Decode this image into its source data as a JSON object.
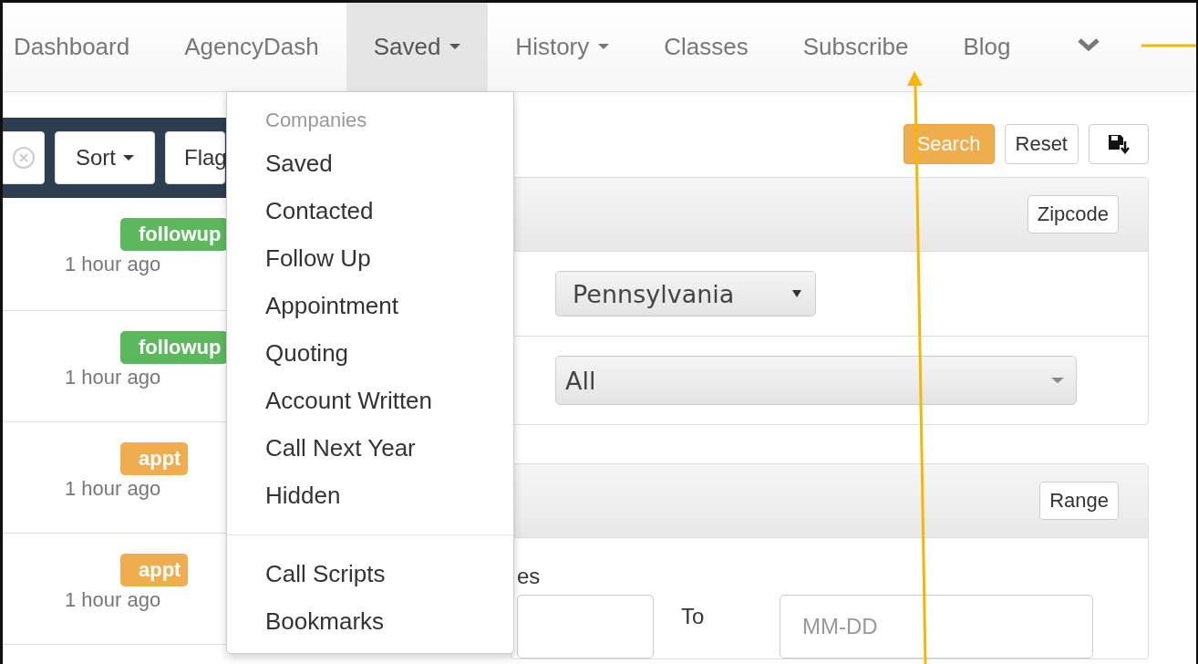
{
  "nav": {
    "items": [
      {
        "label": "Dashboard",
        "selected": false,
        "caret": false
      },
      {
        "label": "AgencyDash",
        "selected": false,
        "caret": false
      },
      {
        "label": "Saved",
        "selected": true,
        "caret": true
      },
      {
        "label": "History",
        "selected": false,
        "caret": true
      },
      {
        "label": "Classes",
        "selected": false,
        "caret": false
      },
      {
        "label": "Subscribe",
        "selected": false,
        "caret": false
      },
      {
        "label": "Blog",
        "selected": false,
        "caret": false
      }
    ]
  },
  "saved_menu": {
    "sections": [
      {
        "header": "Companies",
        "items": [
          "Saved",
          "Contacted",
          "Follow Up",
          "Appointment",
          "Quoting",
          "Account Written",
          "Call Next Year",
          "Hidden"
        ]
      },
      {
        "items": [
          "Call Scripts",
          "Bookmarks"
        ]
      }
    ]
  },
  "toolbar": {
    "buttons": [
      {
        "label": "Sort",
        "caret": true
      },
      {
        "label": "Flag",
        "caret": false
      }
    ]
  },
  "activity": [
    {
      "tag": "followup",
      "color": "#5cb85c",
      "time": "1 hour ago"
    },
    {
      "tag": "followup",
      "color": "#5cb85c",
      "time": "1 hour ago"
    },
    {
      "tag": "appt",
      "color": "#f0ad4e",
      "time": "1 hour ago"
    },
    {
      "tag": "appt",
      "color": "#f0ad4e",
      "time": "1 hour ago"
    }
  ],
  "search_actions": {
    "buttons": [
      {
        "label": "Search",
        "kind": "primary"
      },
      {
        "label": "Reset",
        "kind": "default"
      }
    ]
  },
  "location_panel": {
    "button": "Zipcode",
    "state_select": "Pennsylvania",
    "county_select": "All"
  },
  "date_panel": {
    "button": "Range",
    "label": "es",
    "to_label": "To",
    "to_placeholder": "MM-DD"
  }
}
